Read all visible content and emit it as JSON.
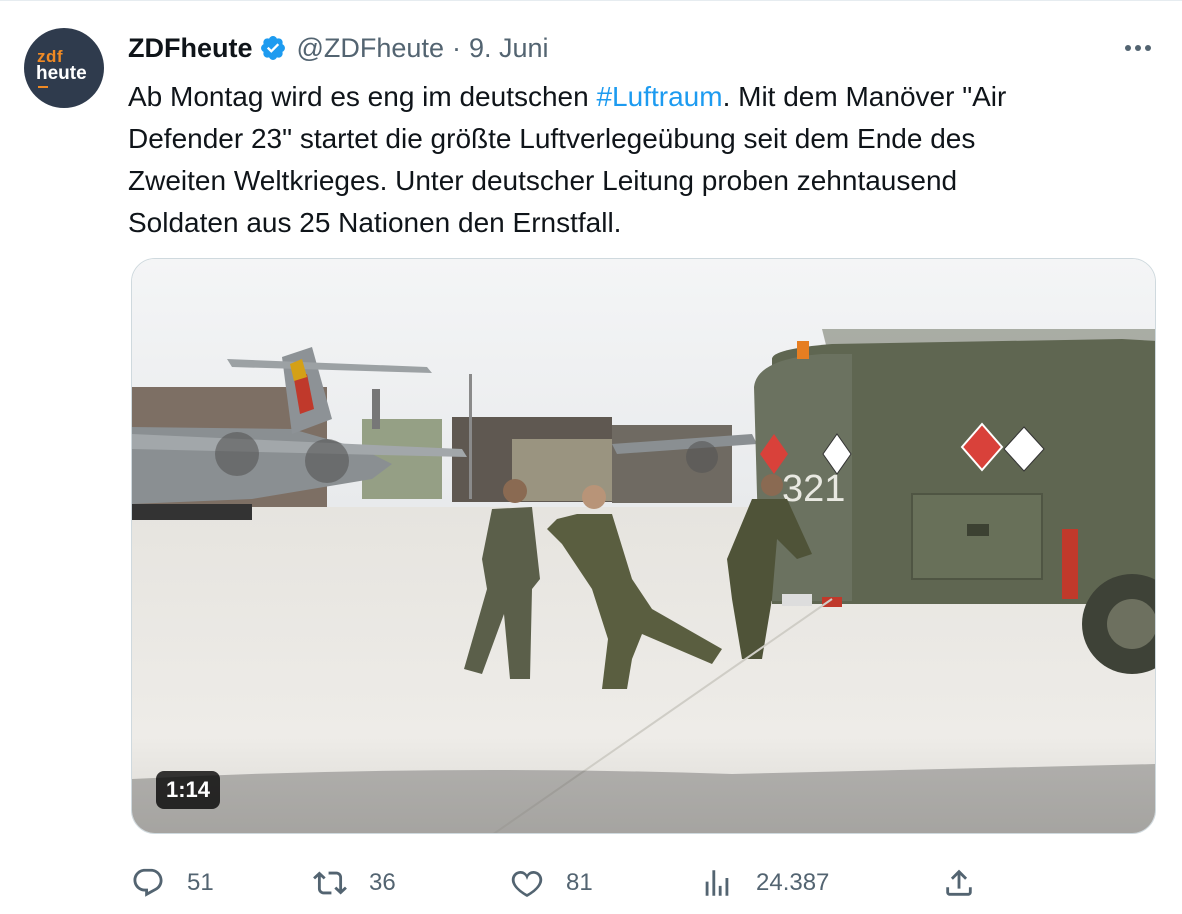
{
  "tweet": {
    "avatar": {
      "line1": "zdf",
      "line2": "heute"
    },
    "author_name": "ZDFheute",
    "handle": "@ZDFheute",
    "separator": "·",
    "date": "9. Juni",
    "text": {
      "line1_before": "Ab Montag wird es eng im deutschen ",
      "hashtag": "#Luftraum",
      "line1_after": ". Mit dem Manöver \"Air",
      "line2": "Defender 23\" startet die größte Luftverlegeübung seit dem Ende des",
      "line3": "Zweiten Weltkrieges. Unter deutscher Leitung proben zehntausend",
      "line4": "Soldaten aus 25 Nationen den Ernstfall."
    },
    "video": {
      "duration": "1:14",
      "truck_number": "321"
    },
    "stats": {
      "replies": "51",
      "retweets": "36",
      "likes": "81",
      "views": "24.387"
    }
  },
  "colors": {
    "hashtag": "#1d9bf0",
    "verified": "#1d9bf0",
    "muted": "#536471"
  }
}
